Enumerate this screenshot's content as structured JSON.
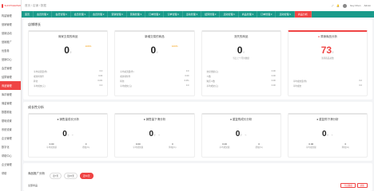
{
  "sidebar": {
    "logo_text": "SHOPKEEPER",
    "items": [
      {
        "label": "构建管理"
      },
      {
        "label": "营销管理"
      },
      {
        "label": "营销活动"
      },
      {
        "label": "营销推广"
      },
      {
        "label": "优惠券"
      },
      {
        "label": "营销中心"
      },
      {
        "label": "会员管理"
      },
      {
        "label": "结算管理"
      },
      {
        "label": "商品管理"
      },
      {
        "label": "库存管理"
      },
      {
        "label": "佣金管理"
      },
      {
        "label": "数据看板"
      },
      {
        "label": "基础设置"
      },
      {
        "label": "系统设置"
      },
      {
        "label": "企业管理"
      },
      {
        "label": "数字化"
      },
      {
        "label": "帮助中心"
      },
      {
        "label": "企业管理"
      },
      {
        "label": "帮助"
      }
    ]
  },
  "topbar": {
    "breadcrumb": "首页 / 店铺 / 数据",
    "user_name": "Guy Chen",
    "admin_label": "Admin"
  },
  "nav": {
    "items": [
      "首页",
      "会员管理 ▾",
      "会员管理 ▾",
      "会员管理 ▾",
      "会员管理 ▾",
      "营销管理 ▾",
      "营销管理 ▾",
      "订单管理 ▾",
      "订单管理 ▾",
      "活动管理 ▾",
      "结算管理 ▾",
      "活动管理 ▾",
      "商品管理 ▾",
      "订单管理 ▾",
      "活动管理 ▾",
      "商品分析"
    ]
  },
  "growth_title": "店铺增长",
  "cards": [
    {
      "title": "商家交易的商品",
      "value": "0",
      "unit": "个",
      "badge": "100%",
      "red": false,
      "rows": [
        [
          "平均总流量(件)",
          "0.0"
        ],
        [
          "成交转化件",
          "0.00"
        ],
        [
          "转化",
          "0.0%"
        ],
        [
          "平均成交(元)",
          "0.0"
        ]
      ]
    },
    {
      "title": "新增交易的商品",
      "value": "0",
      "unit": "个",
      "badge": "100%",
      "red": false,
      "rows": [
        [
          "平均总流量(件)",
          "0.0"
        ],
        [
          "成交转化件",
          "0.00"
        ],
        [
          "转化",
          "0.0%"
        ],
        [
          "平均成交(元)",
          "0.0"
        ]
      ]
    },
    {
      "title": "流失的商品",
      "value": "0",
      "unit": "个",
      "badge": "",
      "red": false,
      "note": "当日上个月的数据",
      "rows": [
        [
          "交易金额(元)",
          "0.00"
        ],
        [
          "人数",
          "0.00"
        ],
        [
          "购买人数",
          "0.00"
        ],
        [
          "平均成交(元)",
          "0.00"
        ]
      ]
    },
    {
      "title": "滞销商品分析",
      "value": "73",
      "unit": "个",
      "badge": "",
      "red": true,
      "note": "滞销商品总数",
      "rows": [
        [
          "平均成交量(件)",
          "0.0"
        ],
        [
          "平均成交",
          "0.0"
        ]
      ]
    }
  ],
  "trend_title": "成长性分析",
  "trend_cards": [
    {
      "title": "销售量成长分析",
      "value": "0",
      "unit": "个",
      "a_val": "0.00",
      "a_lbl": "平均成交额",
      "b_val": "0",
      "b_lbl": "增幅(%)"
    },
    {
      "title": "销售量下滑分析",
      "value": "0",
      "unit": "个",
      "a_val": "0.00",
      "a_lbl": "平均成交额",
      "b_val": "0",
      "b_lbl": "降幅(%)"
    },
    {
      "title": "重复购成长分析",
      "value": "0",
      "unit": "个",
      "a_val": "0.00",
      "a_lbl": "平均成交额",
      "b_val": "0",
      "b_lbl": "增幅(%)"
    },
    {
      "title": "重复购下滑分析",
      "value": "0",
      "unit": "个",
      "a_val": "0.00",
      "a_lbl": "平均成交额",
      "b_val": "0",
      "b_lbl": "降幅(%)"
    }
  ],
  "bottom": {
    "title": "商品推广分析",
    "tabs": [
      "近7天",
      "近15天",
      "近30天"
    ],
    "active_tab": 2,
    "row_label": "全部商品",
    "btn1": "导出数据",
    "btn2": "刷新"
  },
  "colors": {
    "accent": "#ef4444",
    "nav": "#1a9a8a"
  }
}
